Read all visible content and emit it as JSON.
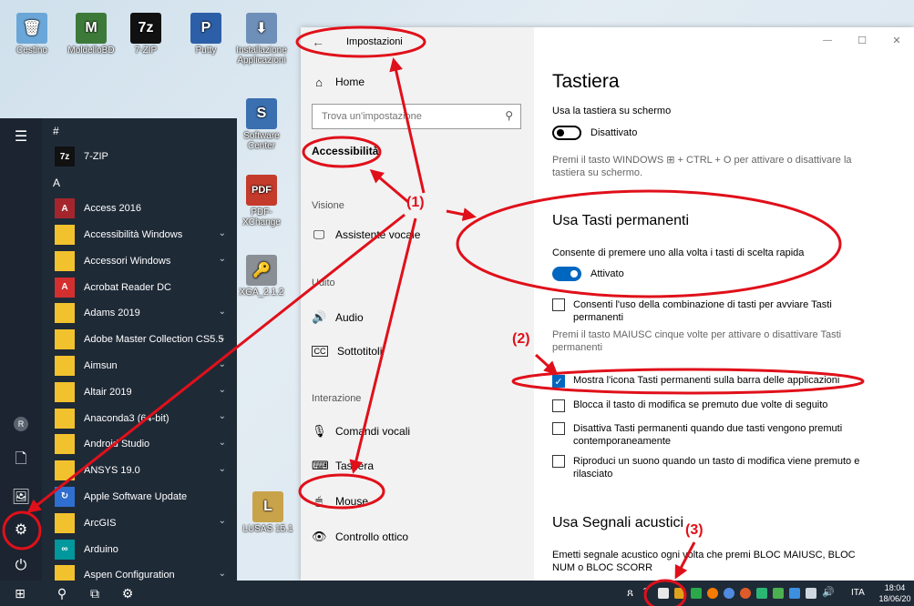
{
  "desktop": {
    "icons": [
      {
        "label": "Cestino",
        "glyph": "🗑",
        "color": "#6aa7d8"
      },
      {
        "label": "MoldelloBD",
        "glyph": "M",
        "color": "#3d7a3a"
      },
      {
        "label": "7-ZIP",
        "glyph": "7z",
        "color": "#111111"
      },
      {
        "label": "Putty",
        "glyph": "P",
        "color": "#2d5fa8"
      },
      {
        "label": "Installazione Applicazioni",
        "glyph": "⬇",
        "color": "#6e8fb8"
      },
      {
        "label": "Software Center",
        "glyph": "S",
        "color": "#3a6fb0"
      },
      {
        "label": "PDF-XChange",
        "glyph": "PDF",
        "color": "#c43b2b"
      },
      {
        "label": "XGA_2.1.2",
        "glyph": "🔑",
        "color": "#8a8f96"
      },
      {
        "label": "LUSAS 15.1",
        "glyph": "L",
        "color": "#c9a34a"
      }
    ]
  },
  "start_menu": {
    "rail": {
      "hamburger": "☰",
      "user": "R",
      "documents": "🗋",
      "pictures": "🖼",
      "settings": "⚙",
      "power": "⏻"
    },
    "groups": [
      {
        "letter": "#",
        "items": [
          {
            "label": "7-ZIP",
            "tile": "7z",
            "color": "#111111",
            "chevron": false
          }
        ]
      },
      {
        "letter": "A",
        "items": [
          {
            "label": "Access 2016",
            "tile": "A",
            "color": "#a4262c",
            "chevron": false
          },
          {
            "label": "Accessibilità Windows",
            "tile": "",
            "color": "#f2c12e",
            "chevron": true
          },
          {
            "label": "Accessori Windows",
            "tile": "",
            "color": "#f2c12e",
            "chevron": true
          },
          {
            "label": "Acrobat Reader DC",
            "tile": "A",
            "color": "#d32f2f",
            "chevron": false
          },
          {
            "label": "Adams 2019",
            "tile": "",
            "color": "#f2c12e",
            "chevron": true
          },
          {
            "label": "Adobe Master Collection CS5.5",
            "tile": "",
            "color": "#f2c12e",
            "chevron": true
          },
          {
            "label": "Aimsun",
            "tile": "",
            "color": "#f2c12e",
            "chevron": true
          },
          {
            "label": "Altair 2019",
            "tile": "",
            "color": "#f2c12e",
            "chevron": true
          },
          {
            "label": "Anaconda3 (64-bit)",
            "tile": "",
            "color": "#f2c12e",
            "chevron": true
          },
          {
            "label": "Android Studio",
            "tile": "",
            "color": "#f2c12e",
            "chevron": true
          },
          {
            "label": "ANSYS 19.0",
            "tile": "",
            "color": "#f2c12e",
            "chevron": true
          },
          {
            "label": "Apple Software Update",
            "tile": "↻",
            "color": "#2f6fd0",
            "chevron": false
          },
          {
            "label": "ArcGIS",
            "tile": "",
            "color": "#f2c12e",
            "chevron": true
          },
          {
            "label": "Arduino",
            "tile": "∞",
            "color": "#00979d",
            "chevron": false
          },
          {
            "label": "Aspen Configuration",
            "tile": "",
            "color": "#f2c12e",
            "chevron": true
          }
        ]
      }
    ]
  },
  "settings": {
    "title": "Impostazioni",
    "back": "←",
    "window_controls": {
      "minimize": "—",
      "maximize": "☐",
      "close": "✕"
    },
    "nav": {
      "home": "Home",
      "search_placeholder": "Trova un'impostazione",
      "category": "Accessibilità",
      "sections": [
        {
          "header": "Visione",
          "items": [
            {
              "label": "Assistente vocale",
              "icon": "🖵"
            }
          ]
        },
        {
          "header": "Udito",
          "items": [
            {
              "label": "Audio",
              "icon": "🔊"
            },
            {
              "label": "Sottotitoli",
              "icon": "CC"
            }
          ]
        },
        {
          "header": "Interazione",
          "items": [
            {
              "label": "Comandi vocali",
              "icon": "🎙"
            },
            {
              "label": "Tastiera",
              "icon": "⌨"
            },
            {
              "label": "Mouse",
              "icon": "🖱"
            },
            {
              "label": "Controllo ottico",
              "icon": "👁"
            }
          ]
        }
      ]
    },
    "content": {
      "page_title": "Tastiera",
      "onscreen": {
        "label": "Usa la tastiera su schermo",
        "state": "Disattivato",
        "hint": "Premi il tasto WINDOWS ⊞ + CTRL + O per attivare o disattivare la tastiera su schermo."
      },
      "sticky": {
        "title": "Usa Tasti permanenti",
        "label": "Consente di premere uno alla volta i tasti di scelta rapida",
        "state": "Attivato",
        "checkbox_shortcut": "Consenti l'uso della combinazione di tasti per avviare Tasti permanenti",
        "shortcut_hint": "Premi il tasto MAIUSC cinque volte per attivare o disattivare Tasti permanenti",
        "checkbox_taskbar": "Mostra l'icona Tasti permanenti sulla barra delle applicazioni",
        "checkbox_lock": "Blocca il tasto di modifica se premuto due volte di seguito",
        "checkbox_disable": "Disattiva Tasti permanenti quando due tasti vengono premuti contemporaneamente",
        "checkbox_sound": "Riproduci un suono quando un tasto di modifica viene premuto e rilasciato"
      },
      "beeps": {
        "title": "Usa Segnali acustici",
        "label": "Emetti segnale acustico ogni volta che premi BLOC MAIUSC, BLOC NUM o BLOC SCORR"
      }
    }
  },
  "taskbar": {
    "start": "⊞",
    "search": "⚲",
    "taskview": "⧉",
    "settings": "⚙",
    "people": "ጸ",
    "chevron": "ˆ",
    "volume": "🔊",
    "language": "ITA",
    "time": "18:04",
    "date": "18/06/20"
  },
  "annotations": {
    "label1": "(1)",
    "label2": "(2)",
    "label3": "(3)",
    "color": "#e0101a"
  }
}
